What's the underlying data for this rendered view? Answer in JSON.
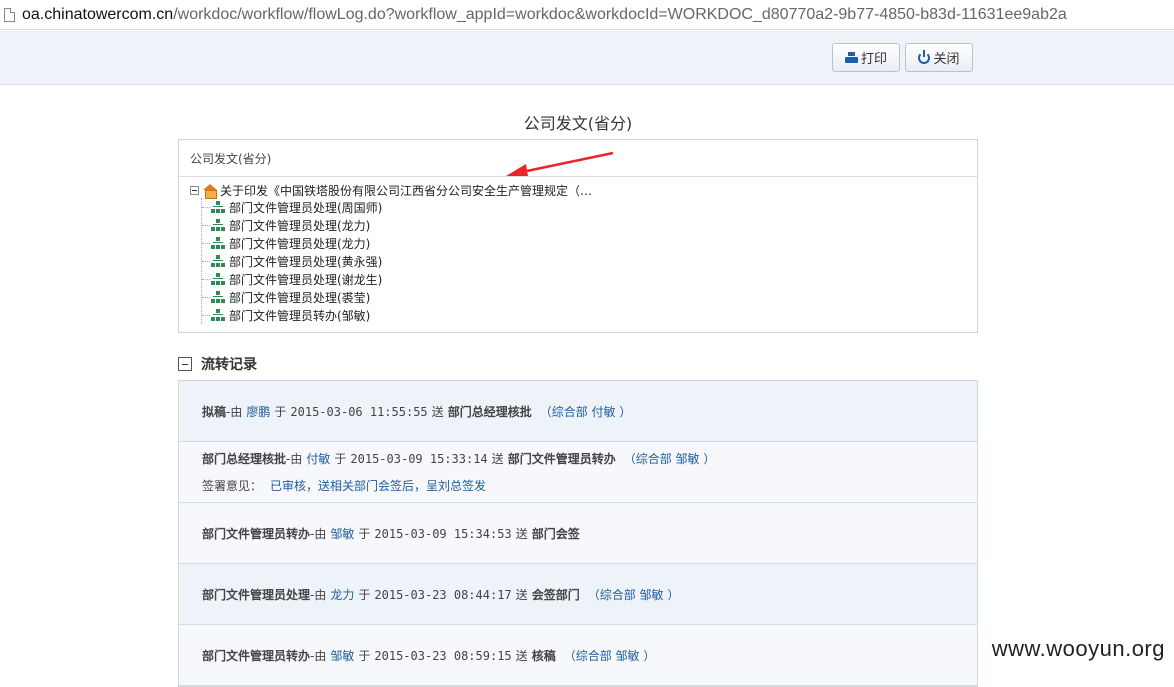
{
  "address_bar": {
    "host": "oa.chinatowercom.cn",
    "path": "/workdoc/workflow/flowLog.do?workflow_appId=workdoc&workdocId=WORKDOC_d80770a2-9b77-4850-b83d-11631ee9ab2a"
  },
  "toolbar": {
    "print_label": "打印",
    "close_label": "关闭"
  },
  "page_title": "公司发文(省分)",
  "tree": {
    "header": "公司发文(省分)",
    "root_label": "关于印发《中国铁塔股份有限公司江西省分公司安全生产管理规定（…",
    "children": [
      "部门文件管理员处理(周国师)",
      "部门文件管理员处理(龙力)",
      "部门文件管理员处理(龙力)",
      "部门文件管理员处理(黄永强)",
      "部门文件管理员处理(谢龙生)",
      "部门文件管理员处理(裘莹)",
      "部门文件管理员转办(邹敏)"
    ]
  },
  "flow": {
    "heading": "流转记录",
    "records": [
      {
        "node": "拟稿",
        "by": "-由",
        "person": "廖鹏",
        "at": "于",
        "time": "2015-03-06 11:55:55",
        "send": "送",
        "target": "部门总经理核批",
        "dept": "（综合部 付敏 ）",
        "comment_label": "",
        "comment": ""
      },
      {
        "node": "部门总经理核批",
        "by": "-由",
        "person": "付敏",
        "at": "于",
        "time": "2015-03-09 15:33:14",
        "send": "送",
        "target": "部门文件管理员转办",
        "dept": "（综合部 邹敏 ）",
        "comment_label": "签署意见：",
        "comment": "已审核，送相关部门会签后，呈刘总签发"
      },
      {
        "node": "部门文件管理员转办",
        "by": "-由",
        "person": "邹敏",
        "at": "于",
        "time": "2015-03-09 15:34:53",
        "send": "送",
        "target": "部门会签",
        "dept": "",
        "comment_label": "",
        "comment": ""
      },
      {
        "node": "部门文件管理员处理",
        "by": "-由",
        "person": "龙力",
        "at": "于",
        "time": "2015-03-23 08:44:17",
        "send": "送",
        "target": "会签部门",
        "dept": "（综合部 邹敏 ）",
        "comment_label": "",
        "comment": ""
      },
      {
        "node": "部门文件管理员转办",
        "by": "-由",
        "person": "邹敏",
        "at": "于",
        "time": "2015-03-23 08:59:15",
        "send": "送",
        "target": "核稿",
        "dept": "（综合部 邹敏 ）",
        "comment_label": "",
        "comment": ""
      }
    ]
  },
  "watermark": "www.wooyun.org",
  "colors": {
    "accent_blue": "#1f5d9c",
    "arrow_red": "#e8262b",
    "toolbar_bg": "#eef3fa"
  }
}
